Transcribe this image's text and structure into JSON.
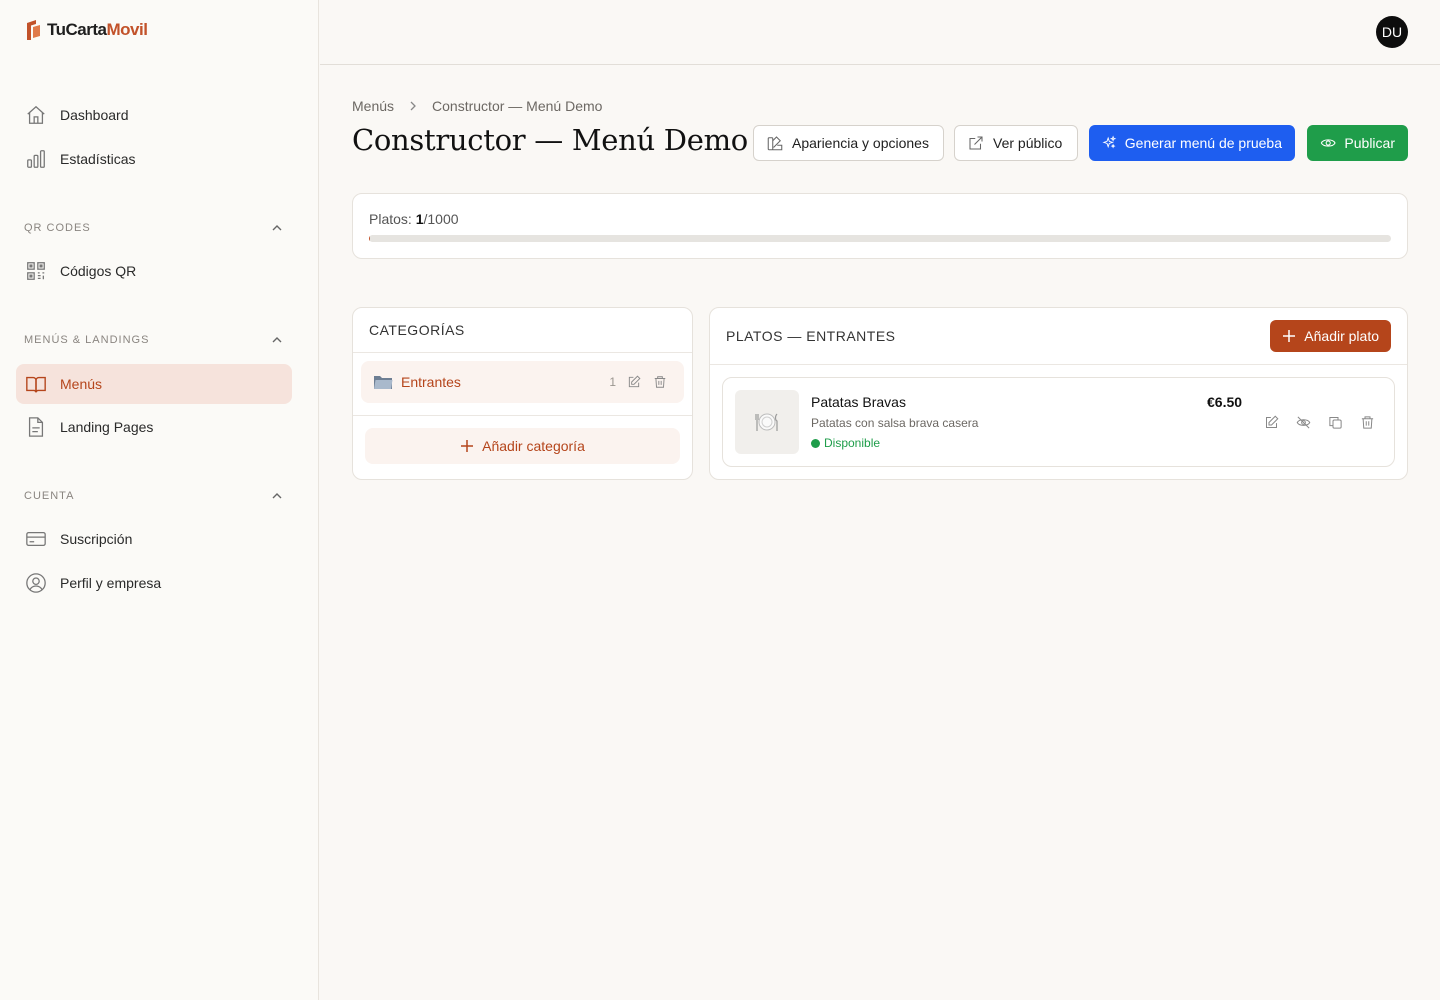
{
  "brand": {
    "name_part1": "TuCarta",
    "name_part2": "Movil",
    "accent_color": "#c2522a"
  },
  "sidebar": {
    "top_items": [
      {
        "label": "Dashboard",
        "icon": "home-icon"
      },
      {
        "label": "Estadísticas",
        "icon": "bar-chart-icon"
      }
    ],
    "sections": [
      {
        "title": "QR CODES",
        "items": [
          {
            "label": "Códigos QR",
            "icon": "qr-code-icon"
          }
        ]
      },
      {
        "title": "MENÚS & LANDINGS",
        "items": [
          {
            "label": "Menús",
            "icon": "book-open-icon",
            "active": true
          },
          {
            "label": "Landing Pages",
            "icon": "file-icon"
          }
        ]
      },
      {
        "title": "CUENTA",
        "items": [
          {
            "label": "Suscripción",
            "icon": "credit-card-icon"
          },
          {
            "label": "Perfil y empresa",
            "icon": "user-circle-icon"
          }
        ]
      }
    ]
  },
  "topbar": {
    "avatar_initials": "DU"
  },
  "breadcrumb": {
    "root": "Menús",
    "current": "Constructor — Menú Demo"
  },
  "page": {
    "title": "Constructor — Menú Demo"
  },
  "actions": {
    "appearance": "Apariencia y opciones",
    "view_public": "Ver público",
    "generate": "Generar menú de prueba",
    "publish": "Publicar"
  },
  "usage": {
    "label": "Platos:",
    "used": "1",
    "limit": "/1000",
    "fraction": 0.001
  },
  "categories": {
    "title": "CATEGORÍAS",
    "items": [
      {
        "name": "Entrantes",
        "count": "1"
      }
    ],
    "add_label": "Añadir categoría"
  },
  "dishes": {
    "title": "PLATOS — ENTRANTES",
    "add_label": "Añadir plato",
    "items": [
      {
        "name": "Patatas Bravas",
        "description": "Patatas con salsa brava casera",
        "status": "Disponible",
        "price": "€6.50"
      }
    ]
  },
  "colors": {
    "primary": "#b5451b",
    "blue": "#1e5ef0",
    "green": "#1f9d4a"
  }
}
